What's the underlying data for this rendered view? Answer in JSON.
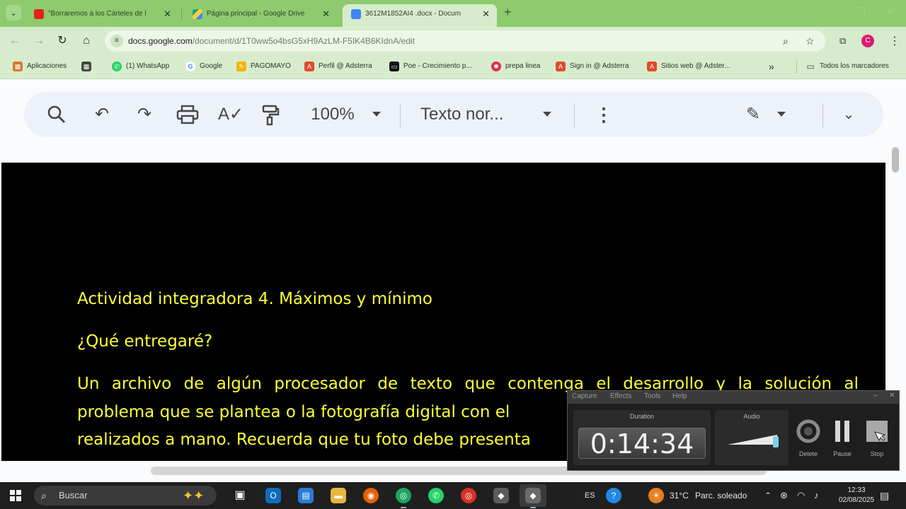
{
  "browser": {
    "tabs": [
      {
        "title": "\"Borraremos a los Cárteles de l",
        "favicon_color": "#e62117"
      },
      {
        "title": "Página principal - Google Drive",
        "favicon_color": "#1fa463"
      },
      {
        "title": "3612M1852AI4 .docx - Docum",
        "favicon_color": "#4285f4"
      }
    ],
    "url_domain": "docs.google.com",
    "url_path": "/document/d/1T0ww5o4bsG5xH9AzLM-F5IK4B6KIdnA/edit",
    "profile_initial": "C",
    "bookmarks": [
      {
        "label": "Aplicaciones",
        "icon": "apps-grid-icon"
      },
      {
        "label": "",
        "icon": "grid-icon"
      },
      {
        "label": "(1) WhatsApp",
        "icon": "whatsapp-icon"
      },
      {
        "label": "Google",
        "icon": "google-icon"
      },
      {
        "label": "PAGOMAYO",
        "icon": "pagomayo-icon"
      },
      {
        "label": "Perfil @ Adsterra",
        "icon": "adsterra-icon"
      },
      {
        "label": "Poe - Crecimiento p...",
        "icon": "poe-icon"
      },
      {
        "label": "prepa linea",
        "icon": "prepa-icon"
      },
      {
        "label": "Sign in @ Adsterra",
        "icon": "adsterra-icon"
      },
      {
        "label": "Sitios web @ Adster...",
        "icon": "adsterra-icon"
      }
    ],
    "all_bookmarks": "Todos los marcadores",
    "more_bookmarks": "»"
  },
  "docs_toolbar": {
    "zoom": "100%",
    "style": "Texto nor..."
  },
  "document": {
    "title": "Actividad integradora 4. Máximos y mínimo",
    "question": "¿Qué entregaré?",
    "line1": "Un archivo de algún procesador de texto que contenga el desarrollo y la solución al",
    "line2": "problema que se plantea o la fotografía digital con el",
    "line3": "realizados a mano. Recuerda que tu foto debe presenta"
  },
  "recorder": {
    "menu": [
      "Capture",
      "Effects",
      "Tools",
      "Help"
    ],
    "duration_label": "Duration",
    "duration": "0:14:34",
    "audio_label": "Audio",
    "delete_label": "Delete",
    "pause_label": "Pause",
    "stop_label": "Stop"
  },
  "taskbar": {
    "search_placeholder": "Buscar",
    "language": "ES",
    "weather_temp": "31°C",
    "weather_desc": "Parc. soleado",
    "time": "12:33",
    "date": "02/08/2025"
  },
  "colors": {
    "chrome_frame": "#8dcb6e",
    "chrome_toolbar": "#d7eccd",
    "doc_background": "#000000",
    "doc_text": "#ffff33"
  }
}
